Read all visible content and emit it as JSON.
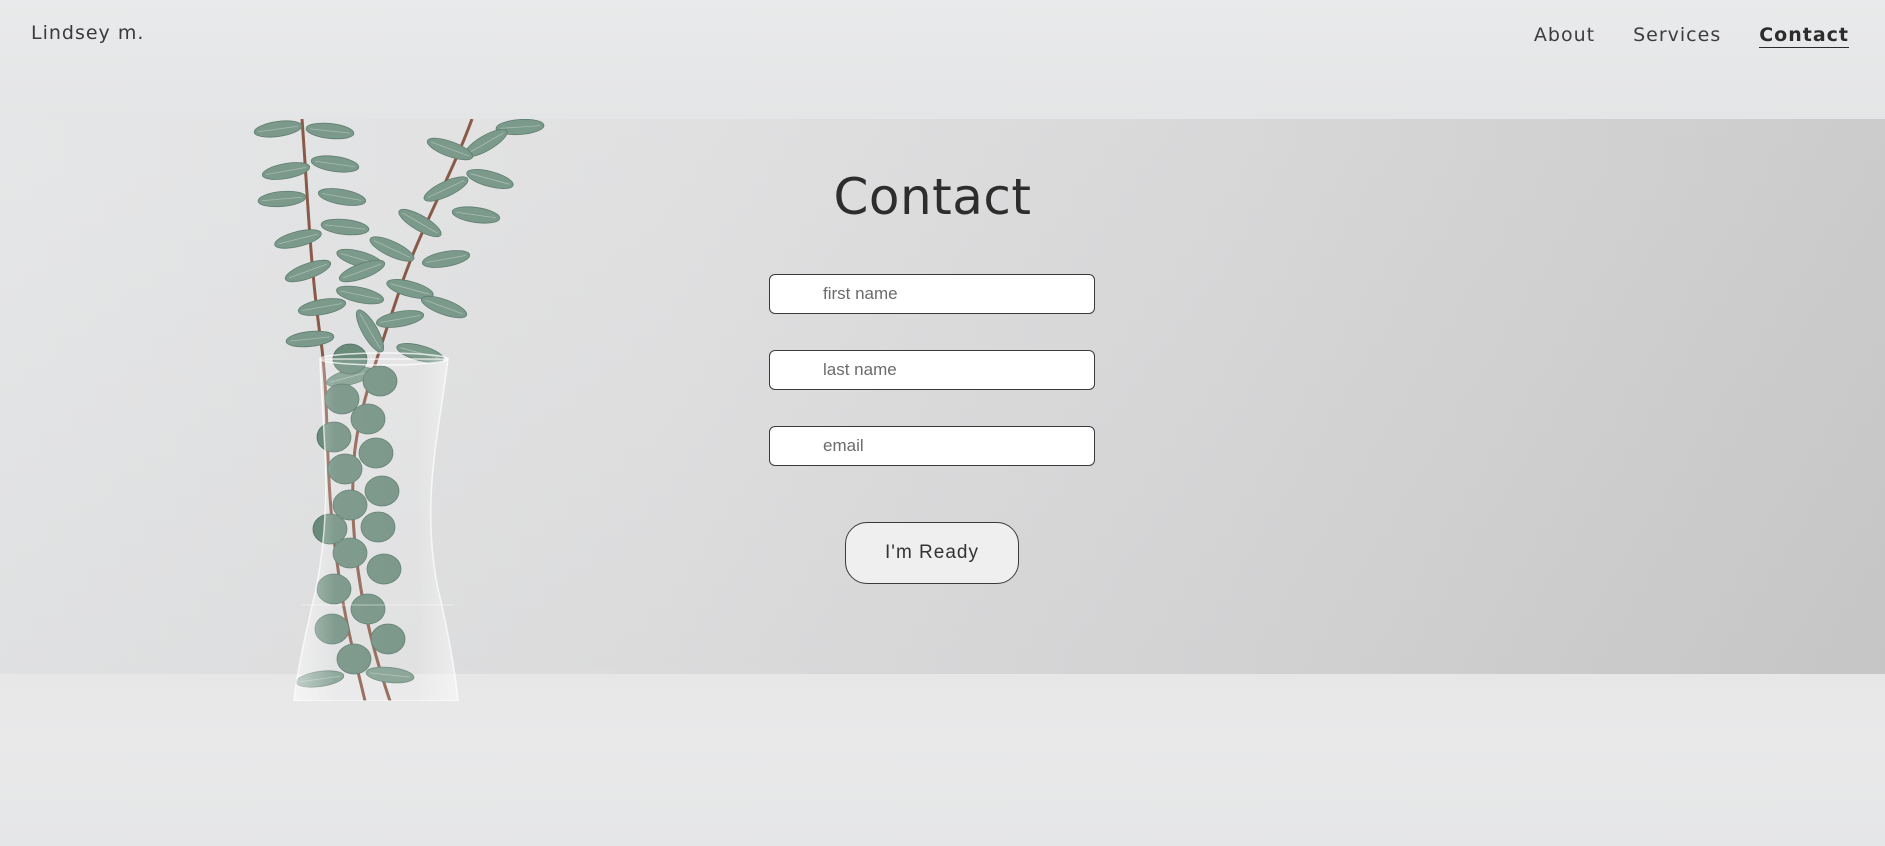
{
  "header": {
    "brand": "Lindsey m.",
    "nav": [
      {
        "label": "About",
        "active": false
      },
      {
        "label": "Services",
        "active": false
      },
      {
        "label": "Contact",
        "active": true
      }
    ]
  },
  "main": {
    "title": "Contact",
    "fields": {
      "first_name_placeholder": "first name",
      "last_name_placeholder": "last name",
      "email_placeholder": "email"
    },
    "submit_label": "I'm Ready"
  },
  "colors": {
    "text": "#333333",
    "leaf": "#7a988a",
    "stem": "#8a5a48",
    "input_bg": "#ffffff",
    "button_bg": "#efefef"
  }
}
